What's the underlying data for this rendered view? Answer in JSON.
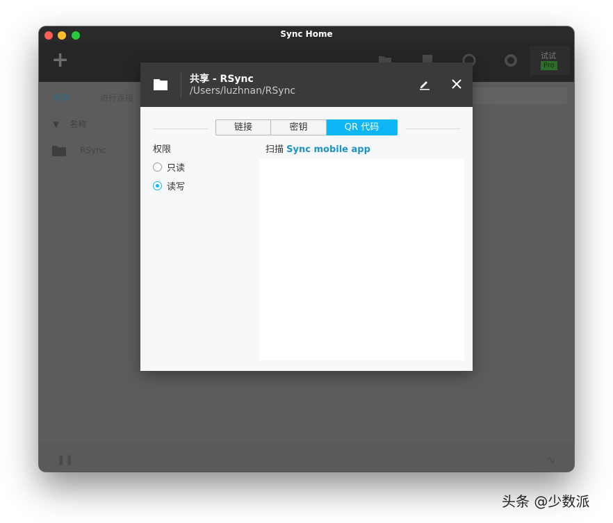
{
  "window": {
    "title": "Sync Home"
  },
  "toolbar": {
    "add_icon": "plus-icon",
    "icons": [
      "folder-icon",
      "transfer-icon",
      "history-icon",
      "gear-icon"
    ],
    "trial_label": "试试",
    "pro_label": "Pro"
  },
  "background": {
    "breadcrumb_root": "所有",
    "breadcrumb_current": "进行连接",
    "column_header": "名称",
    "file_name": "RSync"
  },
  "dialog": {
    "title": "共享 - RSync",
    "path": "/Users/luzhnan/RSync",
    "tabs": [
      {
        "label": "链接"
      },
      {
        "label": "密钥"
      },
      {
        "label": "QR 代码"
      }
    ],
    "active_tab": "QR 代码",
    "permission_label": "权限",
    "options": [
      {
        "label": "只读",
        "checked": false
      },
      {
        "label": "读写",
        "checked": true
      }
    ],
    "scan_prefix": "扫描",
    "scan_link": "Sync mobile app"
  },
  "colors": {
    "accent": "#0fb6f5",
    "link": "#1b93c8",
    "header_bg": "#3a3a3a"
  },
  "watermark": "头条 @少数派"
}
